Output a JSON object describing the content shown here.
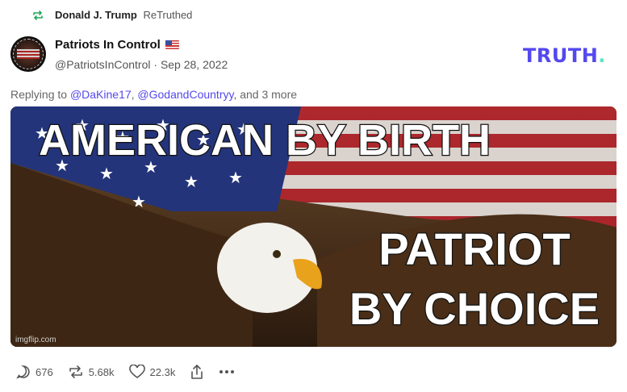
{
  "retruth": {
    "user": "Donald J. Trump",
    "verb": "ReTruthed",
    "icon": "retruth-icon",
    "accent": "#22a55a"
  },
  "post": {
    "display_name": "Patriots In Control",
    "flag": "🇺🇸",
    "handle": "@PatriotsInControl",
    "separator": "·",
    "date": "Sep 28, 2022",
    "reply_prefix": "Replying to",
    "reply_mentions": [
      "@DaKine17",
      "@GodandCountryy"
    ],
    "reply_suffix": "and 3 more",
    "image": {
      "line1": "AMERICAN BY BIRTH",
      "line2": "PATRIOT",
      "line3": "BY CHOICE",
      "watermark": "imgflip.com"
    }
  },
  "brand": {
    "logo_text": "TRUTH",
    "logo_dot": ".",
    "color": "#5448ee",
    "dot_color": "#5be3c9"
  },
  "actions": {
    "replies": "676",
    "retruths": "5.68k",
    "likes": "22.3k"
  }
}
